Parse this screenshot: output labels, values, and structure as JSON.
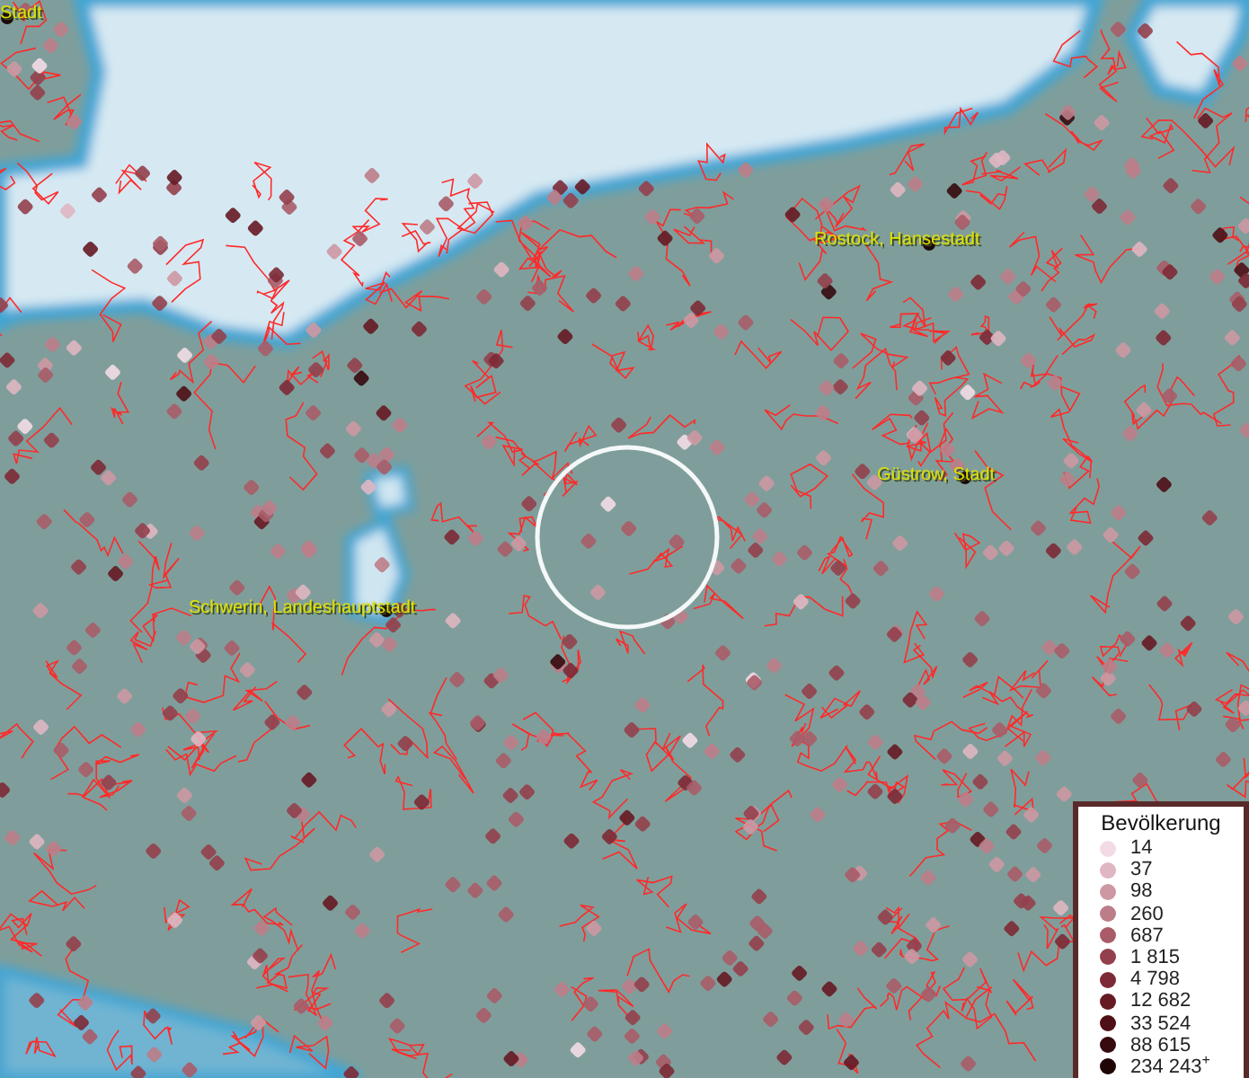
{
  "places": [
    {
      "label": "Stadt"
    },
    {
      "label": "Rostock, Hansestadt"
    },
    {
      "label": "Güstrow, Stadt"
    },
    {
      "label": "Schwerin, Landeshauptstadt"
    }
  ],
  "legend": {
    "title": "Bevölkerung",
    "items": [
      {
        "label": "14",
        "color": "#f3dbe6"
      },
      {
        "label": "37",
        "color": "#e0b6c2"
      },
      {
        "label": "98",
        "color": "#cd98a3"
      },
      {
        "label": "260",
        "color": "#bc7d88"
      },
      {
        "label": "687",
        "color": "#a95c68"
      },
      {
        "label": "1 815",
        "color": "#94404c"
      },
      {
        "label": "4 798",
        "color": "#7d2a36"
      },
      {
        "label": "12 682",
        "color": "#661a24"
      },
      {
        "label": "33 524",
        "color": "#4e0f16"
      },
      {
        "label": "88 615",
        "color": "#360a0e"
      },
      {
        "label": "234 243$^{+}$",
        "color": "#200506"
      }
    ]
  }
}
